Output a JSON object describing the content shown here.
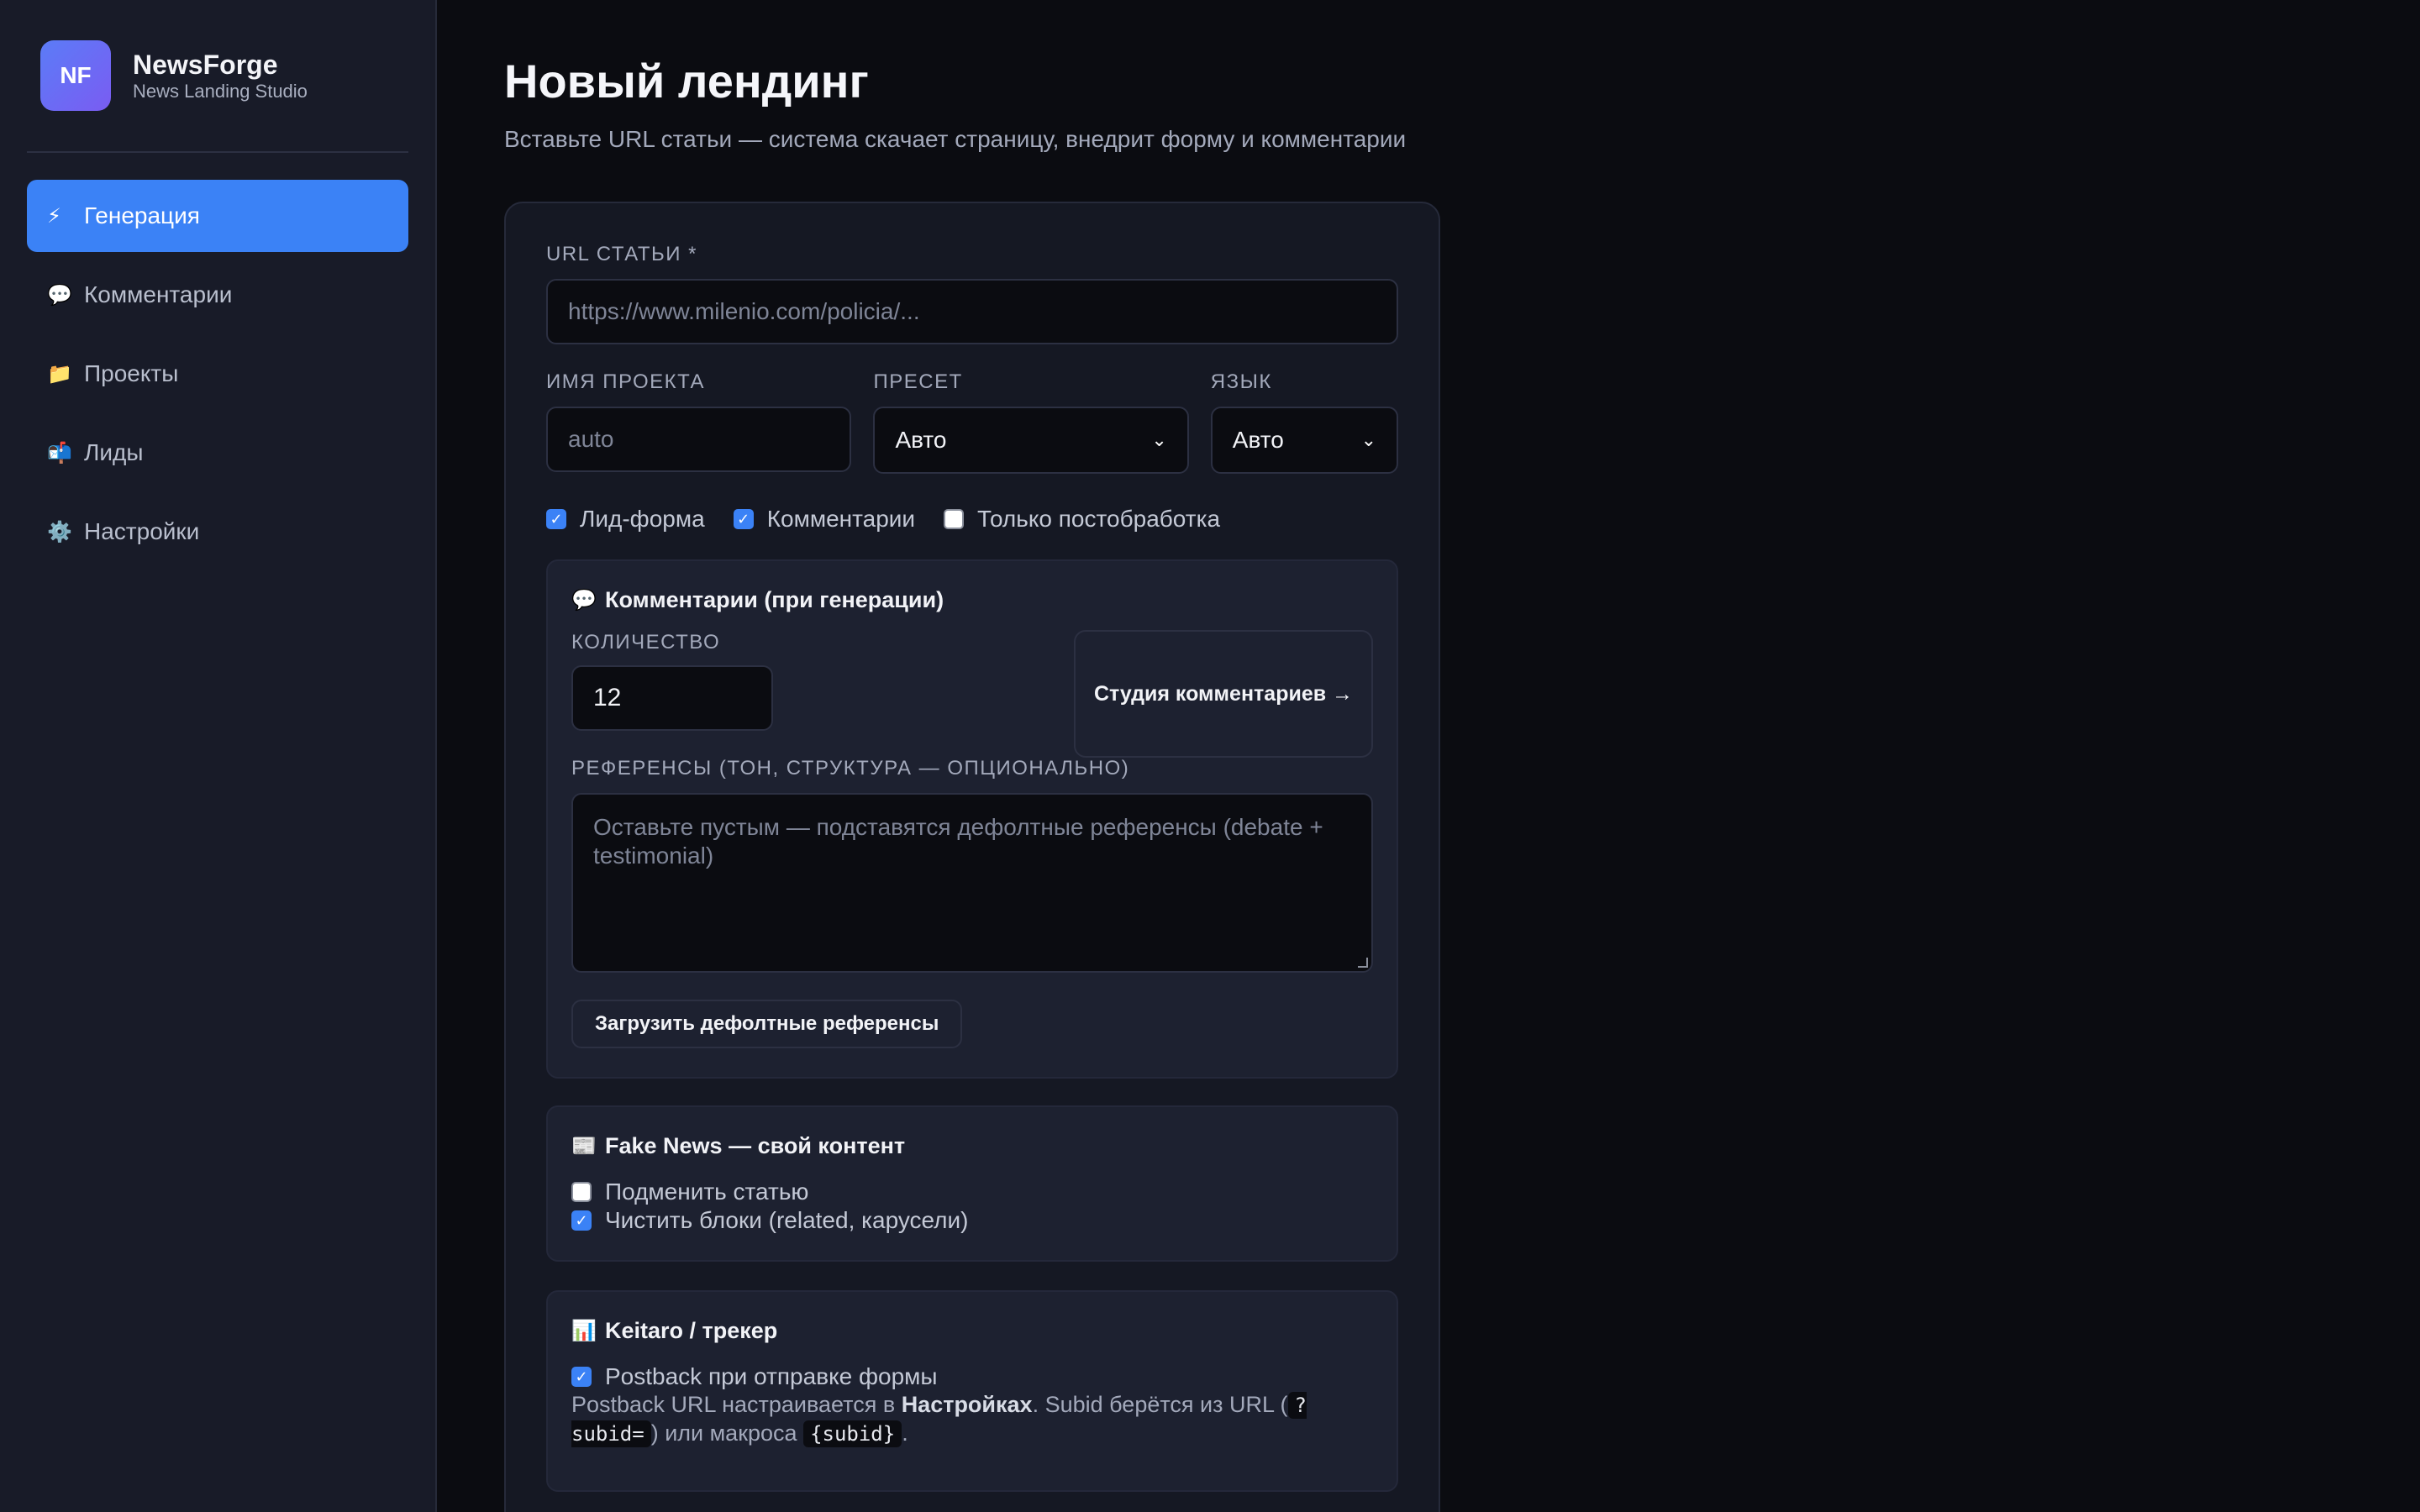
{
  "brand": {
    "logo": "NF",
    "name": "NewsForge",
    "subtitle": "News Landing Studio"
  },
  "sidebar": {
    "items": [
      {
        "icon": "⚡",
        "icon_name": "lightning-icon",
        "label": "Генерация",
        "active": true
      },
      {
        "icon": "💬",
        "icon_name": "speech-bubble-icon",
        "label": "Комментарии"
      },
      {
        "icon": "📁",
        "icon_name": "folder-icon",
        "label": "Проекты"
      },
      {
        "icon": "📬",
        "icon_name": "mailbox-icon",
        "label": "Лиды"
      },
      {
        "icon": "⚙️",
        "icon_name": "gear-icon",
        "label": "Настройки"
      }
    ]
  },
  "page": {
    "title": "Новый лендинг",
    "subtitle": "Вставьте URL статьи — система скачает страницу, внедрит форму и комментарии"
  },
  "form": {
    "url_label": "URL СТАТЬИ *",
    "url_placeholder": "https://www.milenio.com/policia/...",
    "project_label": "ИМЯ ПРОЕКТА",
    "project_placeholder": "auto",
    "preset_label": "ПРЕСЕТ",
    "preset_value": "Авто",
    "lang_label": "ЯЗЫК",
    "lang_value": "Авто",
    "checks": [
      {
        "label": "Лид-форма",
        "checked": true
      },
      {
        "label": "Комментарии",
        "checked": true
      },
      {
        "label": "Только постобработка",
        "checked": false
      }
    ]
  },
  "comments_panel": {
    "icon": "💬",
    "title": "Комментарии (при генерации)",
    "qty_label": "КОЛИЧЕСТВО",
    "qty_value": "12",
    "studio_button": "Студия комментариев →",
    "refs_label": "РЕФЕРЕНСЫ (ТОН, СТРУКТУРА — ОПЦИОНАЛЬНО)",
    "refs_placeholder": "Оставьте пустым — подставятся дефолтные референсы (debate + testimonial)",
    "load_button": "Загрузить дефолтные референсы"
  },
  "fake_panel": {
    "icon": "📰",
    "title": "Fake News — свой контент",
    "checks": [
      {
        "label": "Подменить статью",
        "checked": false
      },
      {
        "label": "Чистить блоки (related, карусели)",
        "checked": true
      }
    ]
  },
  "keitaro_panel": {
    "icon": "📊",
    "title": "Keitaro / трекер",
    "check": {
      "label": "Postback при отправке формы",
      "checked": true
    },
    "note_part1": "Postback URL настраивается в ",
    "note_bold": "Настройках",
    "note_part2": ". Subid берётся из URL (",
    "code1": "?subid=",
    "note_part3": ") или макроса ",
    "code2": "{subid}",
    "note_part4": "."
  },
  "colors": {
    "accent": "#3b82f6",
    "background": "#0b0c11",
    "sidebar": "#181b28",
    "panel": "#1d2130"
  }
}
